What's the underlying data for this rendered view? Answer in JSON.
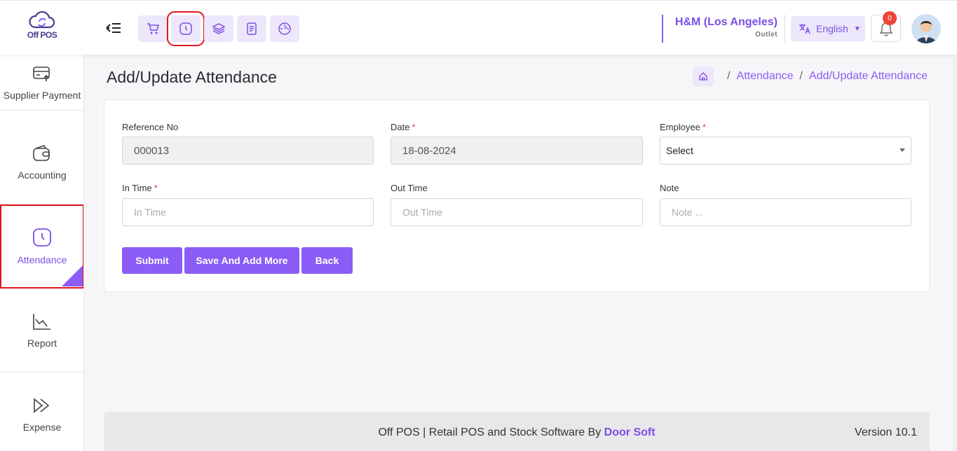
{
  "app": {
    "logo_text": "Off POS"
  },
  "header": {
    "outlet_name": "H&M (Los Angeles)",
    "outlet_sub": "Outlet",
    "language": "English",
    "notification_count": "0"
  },
  "sidebar": {
    "items": [
      {
        "label": "Supplier Payment",
        "icon": "supplier-payment-icon"
      },
      {
        "label": "Accounting",
        "icon": "wallet-icon"
      },
      {
        "label": "Attendance",
        "icon": "clock-icon",
        "active": true
      },
      {
        "label": "Report",
        "icon": "chart-icon"
      },
      {
        "label": "Expense",
        "icon": "expense-icon"
      }
    ]
  },
  "page": {
    "title": "Add/Update Attendance",
    "breadcrumb": [
      "Attendance",
      "Add/Update Attendance"
    ]
  },
  "form": {
    "reference_label": "Reference No",
    "reference_value": "000013",
    "date_label": "Date",
    "date_value": "18-08-2024",
    "employee_label": "Employee",
    "employee_value": "Select",
    "in_time_label": "In Time",
    "in_time_placeholder": "In Time",
    "out_time_label": "Out Time",
    "out_time_placeholder": "Out Time",
    "note_label": "Note",
    "note_placeholder": "Note ...",
    "required_mark": "*"
  },
  "buttons": {
    "submit": "Submit",
    "save_add_more": "Save And Add More",
    "back": "Back"
  },
  "footer": {
    "text_prefix": "Off POS | Retail POS and Stock Software By ",
    "brand": "Door Soft",
    "version": "Version 10.1"
  },
  "colors": {
    "accent": "#8b5cf6",
    "highlight": "#e0171c"
  }
}
